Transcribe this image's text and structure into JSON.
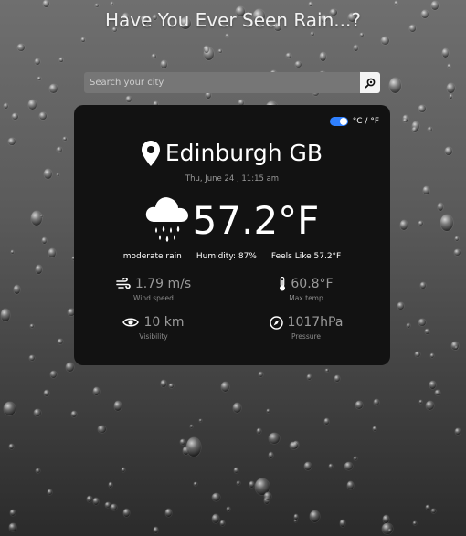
{
  "header": {
    "title": "Have You Ever Seen Rain...?"
  },
  "search": {
    "placeholder": "Search your city",
    "button_icon": "search-icon"
  },
  "card": {
    "unit_toggle": {
      "label": "°C / °F",
      "selected": "F"
    },
    "location": "Edinburgh GB",
    "datetime": "Thu, June 24 , 11:15 am",
    "temperature": "57.2°F",
    "weather_icon": "rain-cloud-icon",
    "description": "moderate rain",
    "humidity": "Humidity: 87%",
    "feels_like": "Feels Like 57.2°F",
    "stats": {
      "wind": {
        "value": "1.79 m/s",
        "label": "Wind speed",
        "icon": "wind-icon"
      },
      "max_temp": {
        "value": "60.8°F",
        "label": "Max temp",
        "icon": "thermometer-icon"
      },
      "visibility": {
        "value": "10 km",
        "label": "Visibility",
        "icon": "eye-icon"
      },
      "pressure": {
        "value": "1017hPa",
        "label": "Pressure",
        "icon": "compass-icon"
      }
    }
  },
  "colors": {
    "card_bg": "#121212",
    "toggle_accent": "#2f80ff",
    "muted_text": "#9a9a9a"
  }
}
